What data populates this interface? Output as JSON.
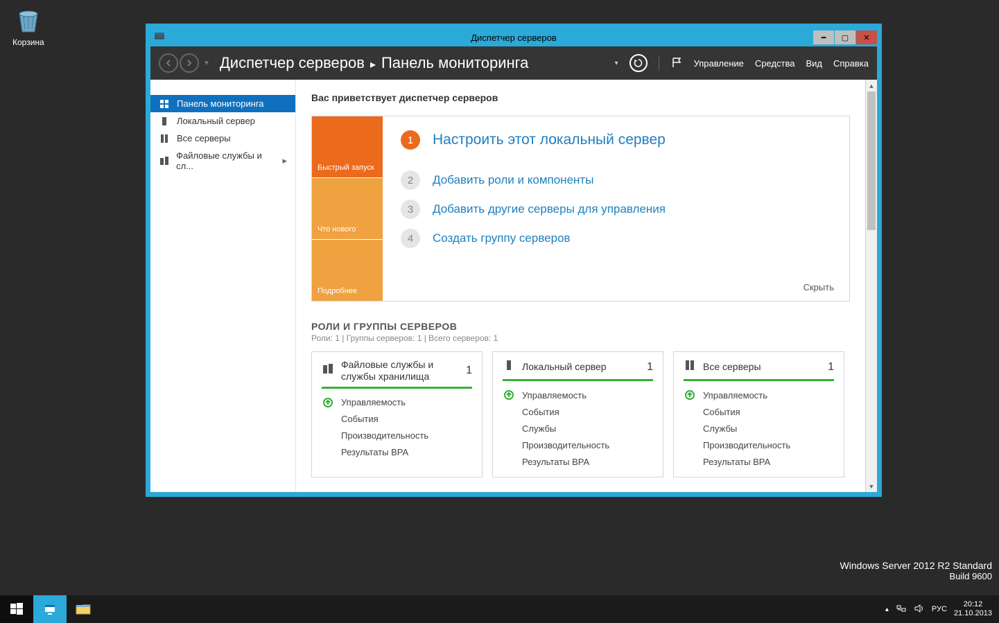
{
  "desktop": {
    "recycle_bin": "Корзина"
  },
  "watermark": {
    "line1": "Windows Server 2012 R2 Standard",
    "line2": "Build 9600"
  },
  "taskbar": {
    "lang": "РУС",
    "time": "20:12",
    "date": "21.10.2013"
  },
  "window": {
    "title": "Диспетчер серверов"
  },
  "toolbar": {
    "crumb1": "Диспетчер серверов",
    "crumb2": "Панель мониторинга",
    "menu": {
      "manage": "Управление",
      "tools": "Средства",
      "view": "Вид",
      "help": "Справка"
    }
  },
  "sidebar": {
    "items": [
      {
        "label": "Панель мониторинга"
      },
      {
        "label": "Локальный сервер"
      },
      {
        "label": "Все серверы"
      },
      {
        "label": "Файловые службы и сл..."
      }
    ]
  },
  "content": {
    "welcome": "Вас приветствует диспетчер серверов",
    "qs_tabs": {
      "t1": "Быстрый запуск",
      "t2": "Что нового",
      "t3": "Подробнее"
    },
    "qs_steps": [
      {
        "n": "1",
        "label": "Настроить этот локальный сервер"
      },
      {
        "n": "2",
        "label": "Добавить роли и компоненты"
      },
      {
        "n": "3",
        "label": "Добавить другие серверы для управления"
      },
      {
        "n": "4",
        "label": "Создать группу серверов"
      }
    ],
    "hide": "Скрыть",
    "roles_heading": "РОЛИ И ГРУППЫ СЕРВЕРОВ",
    "roles_sub": "Роли: 1 | Группы серверов: 1 | Всего серверов: 1",
    "tiles": [
      {
        "title": "Файловые службы и службы хранилища",
        "count": "1",
        "rows": [
          "Управляемость",
          "События",
          "Производительность",
          "Результаты BPA"
        ]
      },
      {
        "title": "Локальный сервер",
        "count": "1",
        "rows": [
          "Управляемость",
          "События",
          "Службы",
          "Производительность",
          "Результаты BPA"
        ]
      },
      {
        "title": "Все серверы",
        "count": "1",
        "rows": [
          "Управляемость",
          "События",
          "Службы",
          "Производительность",
          "Результаты BPA"
        ]
      }
    ]
  }
}
